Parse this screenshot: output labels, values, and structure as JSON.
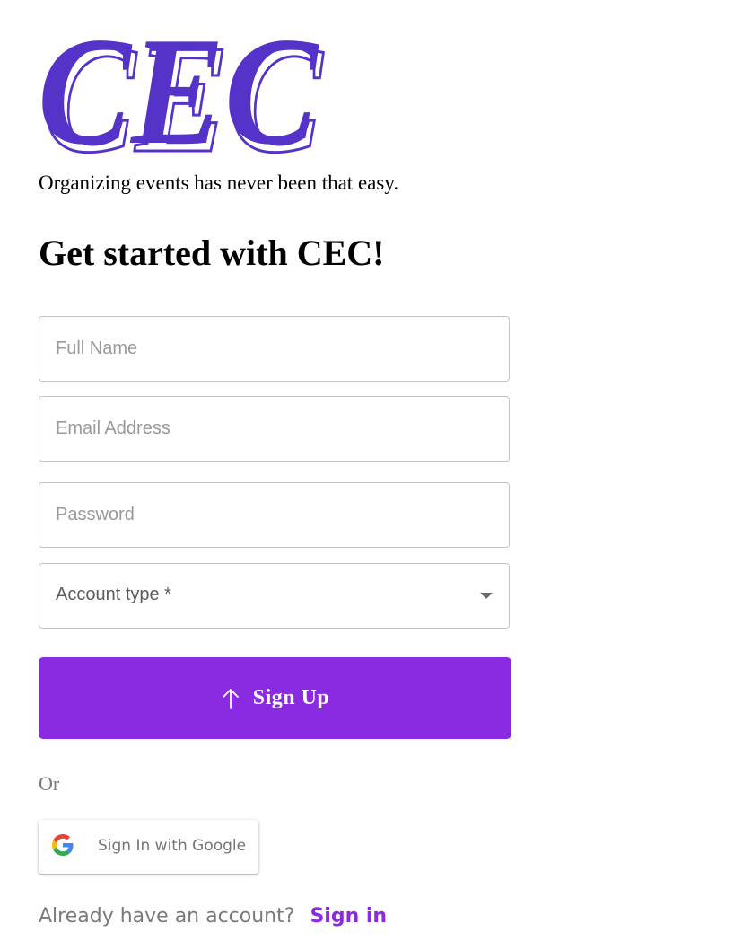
{
  "brand": {
    "logo_text": "CEC",
    "logo_color": "#5533c8",
    "tagline": "Organizing events has never been that easy."
  },
  "heading": "Get started with CEC!",
  "form": {
    "full_name": {
      "placeholder": "Full Name",
      "value": ""
    },
    "email": {
      "placeholder": "Email Address",
      "value": ""
    },
    "password": {
      "placeholder": "Password",
      "value": ""
    },
    "account_type": {
      "label": "Account type *",
      "icon": "chevron-down-icon"
    },
    "submit": {
      "label": "Sign Up",
      "icon": "arrow-up-icon"
    }
  },
  "divider_text": "Or",
  "google": {
    "label": "Sign In with Google",
    "icon": "google-g-icon"
  },
  "footer": {
    "prompt": "Already have an account?",
    "link_label": "Sign in"
  },
  "colors": {
    "accent": "#8a2be2",
    "logo": "#5533c8",
    "muted_text": "#7a7a7a",
    "border": "#c4c4c4"
  }
}
